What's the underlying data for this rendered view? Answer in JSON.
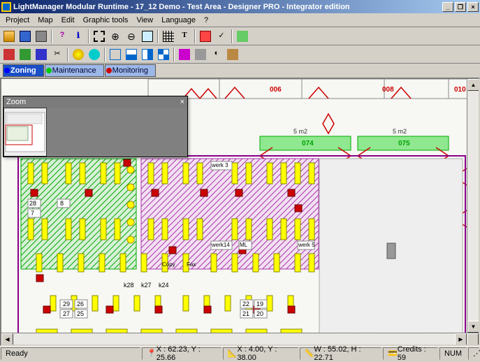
{
  "window": {
    "title": "LightManager Modular Runtime - 17_12 Demo - Test Area - Designer PRO - Integrator edition",
    "min_label": "_",
    "max_label": "❐",
    "close_label": "×"
  },
  "menu": {
    "project": "Project",
    "map": "Map",
    "edit": "Edit",
    "graphictools": "Graphic tools",
    "view": "View",
    "language": "Language",
    "help": "?"
  },
  "tabs": {
    "zoning": "Zoning",
    "maintenance": "Maintenance",
    "monitoring": "Monitoring"
  },
  "zoom": {
    "title": "Zoom",
    "close": "×"
  },
  "labels": {
    "r006": "006",
    "r008": "008",
    "r010": "010",
    "g074": "074",
    "g075": "075",
    "m51": "5 m2",
    "m52": "5 m2",
    "cell28": "28",
    "cell8": "8",
    "cell7": "7",
    "k28": "k28",
    "k27": "k27",
    "k24": "k24",
    "n29": "29",
    "n27": "27",
    "n26": "26",
    "n25": "25",
    "n22": "22",
    "n21": "21",
    "n19": "19",
    "n20": "20",
    "werk3": "werk 3",
    "werk14": "werk14",
    "werk5": "werk 5",
    "copy": "Copy",
    "fax": "Fax",
    "ml": "ML"
  },
  "status": {
    "ready": "Ready",
    "coords": "X : 62.23, Y : 25.66",
    "xywh": "X : 4.00, Y : 38.00",
    "wh": "W : 55.02, H : 22.71",
    "credits": "Credits : 59",
    "num": "NUM"
  }
}
